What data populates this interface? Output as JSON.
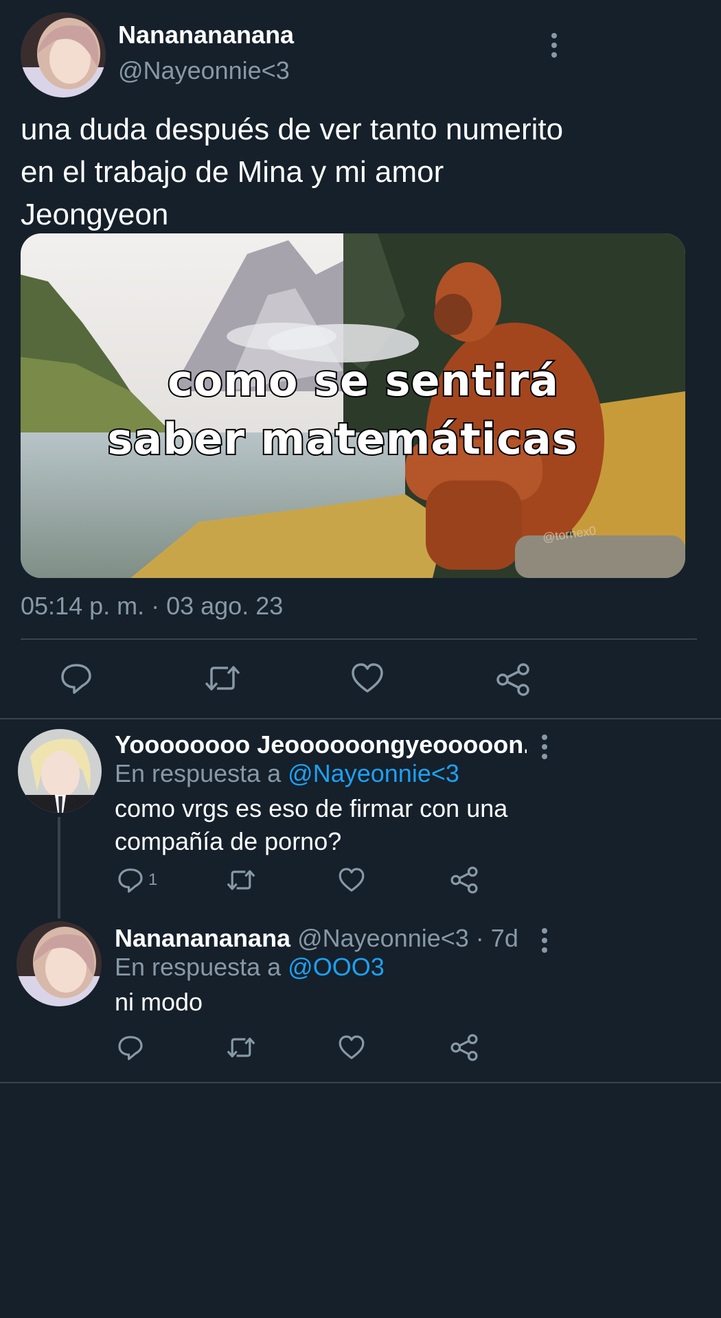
{
  "main_tweet": {
    "display_name": "Nananananana",
    "handle": "@Nayeonnie<3",
    "text_lines": [
      "una duda después de ver tanto numerito",
      "en el trabajo de Mina y mi amor",
      "Jeongyeon"
    ],
    "meme": {
      "caption_line1": "como se sentirá",
      "caption_line2": "saber matemáticas",
      "watermark": "@tornex0"
    },
    "timestamp": "05:14 p. m. · 03 ago. 23",
    "actions": [
      "reply-icon",
      "retweet-icon",
      "like-icon",
      "share-icon"
    ]
  },
  "replies": [
    {
      "display_name": "Yoooooooo Jeoooooongyeooooon...",
      "reply_prefix": "En respuesta a",
      "reply_to": "@Nayeonnie<3",
      "text_lines": [
        "como vrgs es eso de firmar con una",
        "compañía de porno?"
      ],
      "reply_count": "1"
    },
    {
      "display_name": "Nananananana",
      "handle_time": "@Nayeonnie<3 · 7d",
      "reply_prefix": "En respuesta a",
      "reply_to": "@OOO3",
      "text_lines": [
        "ni modo"
      ]
    }
  ],
  "colors": {
    "background": "#15202b",
    "muted": "#8899a6",
    "link": "#1da1f2",
    "divider": "#38444d"
  }
}
